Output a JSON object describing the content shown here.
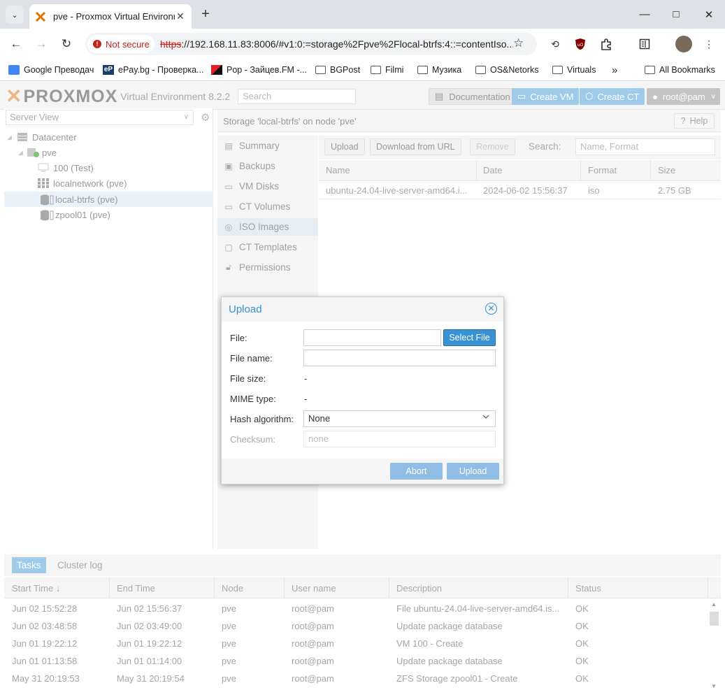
{
  "browser": {
    "tab_title": "pve - Proxmox Virtual Environm",
    "not_secure": "Not secure",
    "url_scheme": "https",
    "url_rest": "://192.168.11.83:8006/#v1:0:=storage%2Fpve%2Flocal-btrfs:4::=contentIso...",
    "bookmarks": [
      "Google Преводач",
      "ePay.bg - Проверка...",
      "Pop - Зайцев.FM -...",
      "BGPost",
      "Filmi",
      "Музика",
      "OS&Netorks",
      "Virtuals",
      "All Bookmarks"
    ],
    "epay_badge": "eP"
  },
  "header": {
    "logo_text": "PROXMOX",
    "version": "Virtual Environment 8.2.2",
    "search_placeholder": "Search",
    "documentation": "Documentation",
    "create_vm": "Create VM",
    "create_ct": "Create CT",
    "user": "root@pam"
  },
  "tree": {
    "view": "Server View",
    "nodes": [
      "Datacenter",
      "pve",
      "100 (Test)",
      "localnetwork (pve)",
      "local-btrfs (pve)",
      "zpool01 (pve)"
    ]
  },
  "main": {
    "title": "Storage 'local-btrfs' on node 'pve'",
    "help": "Help",
    "nav": [
      "Summary",
      "Backups",
      "VM Disks",
      "CT Volumes",
      "ISO Images",
      "CT Templates",
      "Permissions"
    ],
    "toolbar": {
      "upload": "Upload",
      "download": "Download from URL",
      "remove": "Remove",
      "search_label": "Search:",
      "search_placeholder": "Name, Format"
    },
    "columns": [
      "Name",
      "Date",
      "Format",
      "Size"
    ],
    "rows": [
      {
        "name": "ubuntu-24.04-live-server-amd64.i...",
        "date": "2024-06-02 15:56:37",
        "format": "iso",
        "size": "2.75 GB"
      }
    ]
  },
  "dialog": {
    "title": "Upload",
    "file_label": "File:",
    "select_file": "Select File",
    "filename_label": "File name:",
    "filesize_label": "File size:",
    "filesize_value": "-",
    "mime_label": "MIME type:",
    "mime_value": "-",
    "hash_label": "Hash algorithm:",
    "hash_value": "None",
    "checksum_label": "Checksum:",
    "checksum_placeholder": "none",
    "abort": "Abort",
    "upload": "Upload"
  },
  "tasks": {
    "tabs": [
      "Tasks",
      "Cluster log"
    ],
    "columns": [
      "Start Time ↓",
      "End Time",
      "Node",
      "User name",
      "Description",
      "Status"
    ],
    "rows": [
      {
        "start": "Jun 02 15:52:28",
        "end": "Jun 02 15:56:37",
        "node": "pve",
        "user": "root@pam",
        "desc": "File ubuntu-24.04-live-server-amd64.is...",
        "status": "OK"
      },
      {
        "start": "Jun 02 03:48:58",
        "end": "Jun 02 03:49:00",
        "node": "pve",
        "user": "root@pam",
        "desc": "Update package database",
        "status": "OK"
      },
      {
        "start": "Jun 01 19:22:12",
        "end": "Jun 01 19:22:12",
        "node": "pve",
        "user": "root@pam",
        "desc": "VM 100 - Create",
        "status": "OK"
      },
      {
        "start": "Jun 01 01:13:58",
        "end": "Jun 01 01:14:00",
        "node": "pve",
        "user": "root@pam",
        "desc": "Update package database",
        "status": "OK"
      },
      {
        "start": "May 31 20:19:53",
        "end": "May 31 20:19:54",
        "node": "pve",
        "user": "root@pam",
        "desc": "ZFS Storage zpool01 - Create",
        "status": "OK"
      }
    ]
  }
}
